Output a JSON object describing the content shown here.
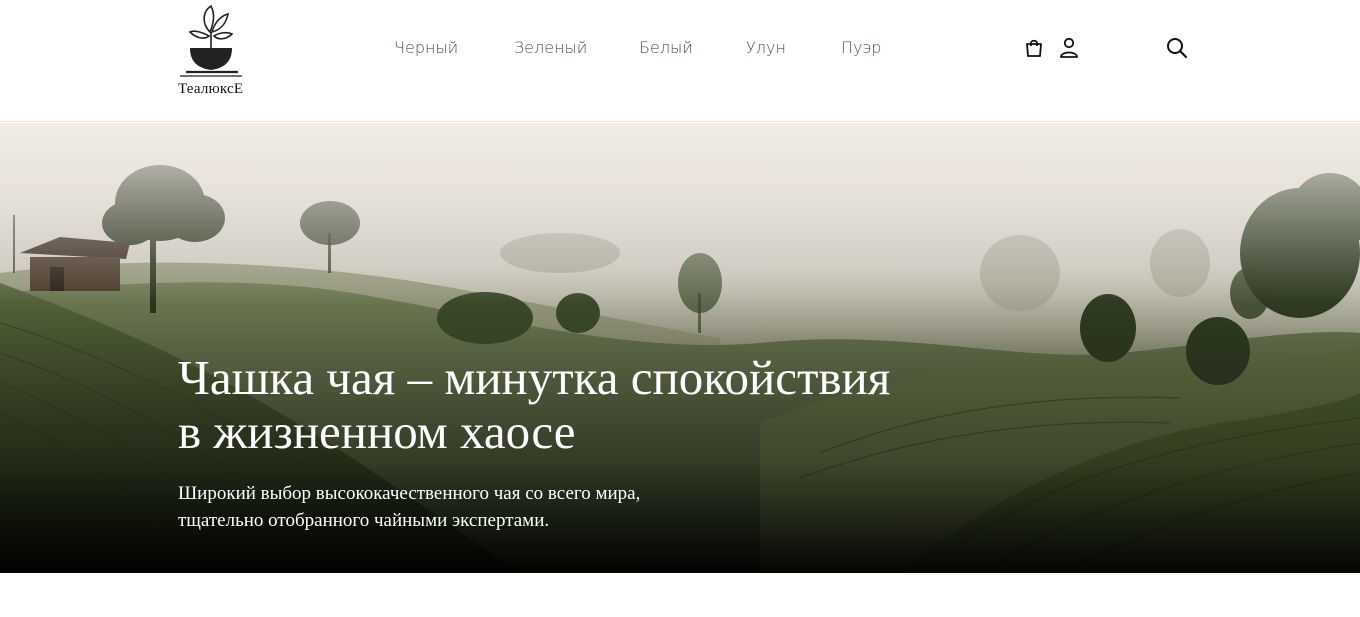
{
  "header": {
    "logo_text": "ТеалюксЕ",
    "nav": [
      {
        "label": "Черный"
      },
      {
        "label": "Зеленый"
      },
      {
        "label": "Белый"
      },
      {
        "label": "Улун"
      },
      {
        "label": "Пуэр"
      }
    ],
    "icons": {
      "cart": "shopping-bag-icon",
      "account": "user-icon",
      "search": "search-icon"
    }
  },
  "hero": {
    "title_line1": "Чашка чая – минутка спокойствия",
    "title_line2": "в жизненном хаосе",
    "subtitle_line1": "Широкий выбор высококачественного чая со всего мира,",
    "subtitle_line2": "тщательно отобранного чайными экспертами."
  },
  "colors": {
    "nav_text": "#5a4a52",
    "hero_text": "#ffffff",
    "background": "#ffffff"
  }
}
